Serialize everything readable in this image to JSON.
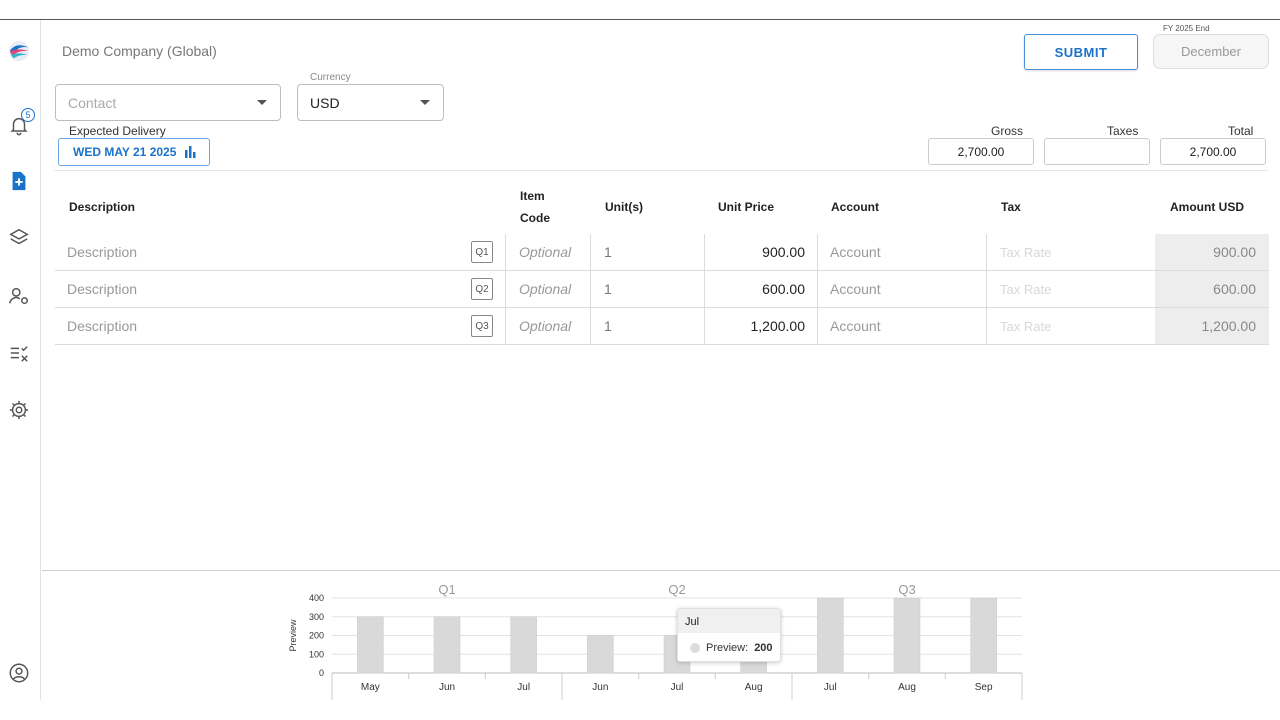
{
  "company": "Demo Company (Global)",
  "notifications_count": "5",
  "fy": {
    "label": "FY 2025 End",
    "value": "December"
  },
  "submit_label": "SUBMIT",
  "contact": {
    "placeholder": "Contact"
  },
  "currency": {
    "label": "Currency",
    "value": "USD"
  },
  "expected_delivery": {
    "label": "Expected Delivery",
    "value": "WED MAY 21 2025"
  },
  "totals": {
    "gross_label": "Gross",
    "gross": "2,700.00",
    "taxes_label": "Taxes",
    "taxes": "",
    "total_label": "Total",
    "total": "2,700.00"
  },
  "table": {
    "headers": {
      "description": "Description",
      "item_code_line1": "Item",
      "item_code_line2": "Code",
      "units": "Unit(s)",
      "unit_price": "Unit Price",
      "account": "Account",
      "tax": "Tax",
      "amount": "Amount USD"
    },
    "rows": [
      {
        "description": "Description",
        "badge": "Q1",
        "code": "Optional",
        "units": "1",
        "price": "900.00",
        "account": "Account",
        "tax": "Tax Rate",
        "amount": "900.00"
      },
      {
        "description": "Description",
        "badge": "Q2",
        "code": "Optional",
        "units": "1",
        "price": "600.00",
        "account": "Account",
        "tax": "Tax Rate",
        "amount": "600.00"
      },
      {
        "description": "Description",
        "badge": "Q3",
        "code": "Optional",
        "units": "1",
        "price": "1,200.00",
        "account": "Account",
        "tax": "Tax Rate",
        "amount": "1,200.00"
      }
    ]
  },
  "tooltip": {
    "title": "Jul",
    "series": "Preview:",
    "value": "200"
  },
  "colors": {
    "accent": "#1a73c9",
    "bar": "#d9d9d9",
    "amount_bg": "#ededed"
  },
  "chart_data": {
    "type": "bar",
    "groups": [
      "Q1",
      "Q2",
      "Q3"
    ],
    "categories": [
      "May",
      "Jun",
      "Jul",
      "Jun",
      "Jul",
      "Aug",
      "Jul",
      "Aug",
      "Sep"
    ],
    "series": [
      {
        "name": "Preview",
        "values": [
          300,
          300,
          300,
          200,
          200,
          200,
          400,
          400,
          400
        ]
      }
    ],
    "ylabel": "Preview",
    "ylim": [
      0,
      400
    ],
    "yticks": [
      0,
      100,
      200,
      300,
      400
    ],
    "grid": true
  }
}
